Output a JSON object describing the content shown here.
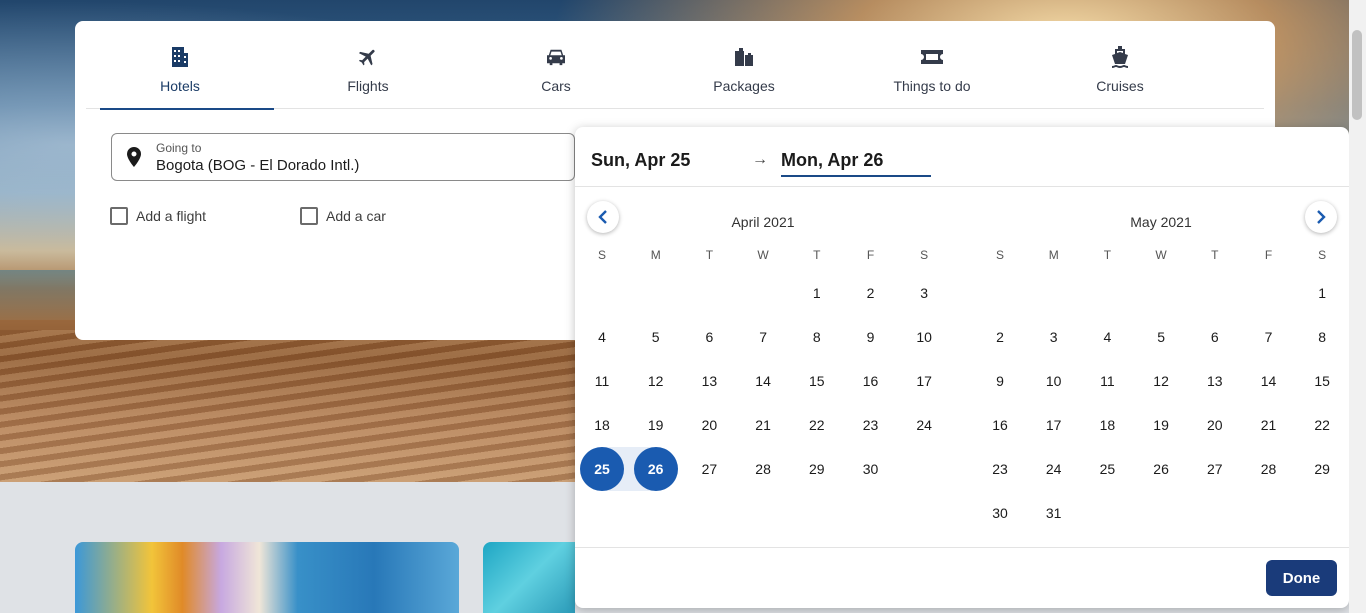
{
  "tabs": [
    {
      "label": "Hotels",
      "icon": "hotel-icon",
      "active": true
    },
    {
      "label": "Flights",
      "icon": "plane-icon",
      "active": false
    },
    {
      "label": "Cars",
      "icon": "car-icon",
      "active": false
    },
    {
      "label": "Packages",
      "icon": "luggage-icon",
      "active": false
    },
    {
      "label": "Things to do",
      "icon": "ticket-icon",
      "active": false
    },
    {
      "label": "Cruises",
      "icon": "ship-icon",
      "active": false
    }
  ],
  "search": {
    "going_to_label": "Going to",
    "going_to_value": "Bogota (BOG - El Dorado Intl.)",
    "add_flight": "Add a flight",
    "add_car": "Add a car"
  },
  "calendar": {
    "start_date": "Sun, Apr 25",
    "end_date": "Mon, Apr 26",
    "done_label": "Done",
    "weekdays": [
      "S",
      "M",
      "T",
      "W",
      "T",
      "F",
      "S"
    ],
    "months": [
      {
        "title": "April 2021",
        "weeks": [
          [
            "",
            "",
            "",
            "",
            "1",
            "2",
            "3"
          ],
          [
            "4",
            "5",
            "6",
            "7",
            "8",
            "9",
            "10"
          ],
          [
            "11",
            "12",
            "13",
            "14",
            "15",
            "16",
            "17"
          ],
          [
            "18",
            "19",
            "20",
            "21",
            "22",
            "23",
            "24"
          ],
          [
            "25",
            "26",
            "27",
            "28",
            "29",
            "30",
            ""
          ]
        ]
      },
      {
        "title": "May 2021",
        "weeks": [
          [
            "",
            "",
            "",
            "",
            "",
            "",
            "1"
          ],
          [
            "2",
            "3",
            "4",
            "5",
            "6",
            "7",
            "8"
          ],
          [
            "9",
            "10",
            "11",
            "12",
            "13",
            "14",
            "15"
          ],
          [
            "16",
            "17",
            "18",
            "19",
            "20",
            "21",
            "22"
          ],
          [
            "23",
            "24",
            "25",
            "26",
            "27",
            "28",
            "29"
          ],
          [
            "30",
            "31",
            "",
            "",
            "",
            "",
            ""
          ]
        ]
      }
    ],
    "selected": [
      "25",
      "26"
    ]
  },
  "colors": {
    "accent": "#1a5bb0",
    "done_button": "#1a3b7a",
    "active_tab": "#1a4a87"
  }
}
